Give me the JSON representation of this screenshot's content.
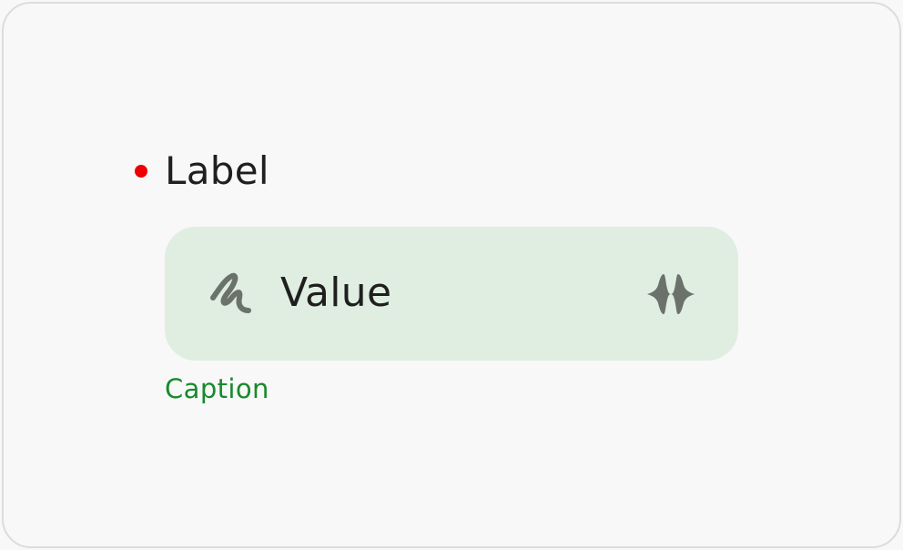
{
  "field": {
    "label": "Label",
    "required": true,
    "value": "Value",
    "caption": "Caption",
    "leading_icon": "handwriting-squiggle-icon",
    "trailing_icon": "voice-waveform-icon"
  },
  "colors": {
    "background": "#f8f8f8",
    "frame_border": "#dcdcdc",
    "required_dot": "#ee0000",
    "field_fill": "#dfeee1",
    "icon": "#6b726c",
    "text": "#1f1f1f",
    "caption": "#188a2c"
  }
}
